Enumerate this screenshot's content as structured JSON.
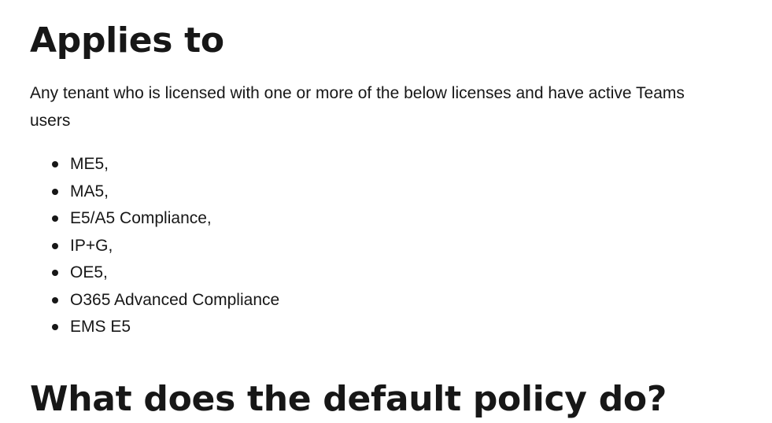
{
  "section_applies": {
    "heading": "Applies to",
    "intro": "Any tenant who is licensed with one or more of the below licenses and have active Teams users",
    "licenses": [
      "ME5,",
      "MA5,",
      "E5/A5 Compliance,",
      "IP+G,",
      "OE5,",
      "O365 Advanced Compliance",
      "EMS E5"
    ]
  },
  "section_default_policy": {
    "heading": "What does the default policy do?"
  }
}
